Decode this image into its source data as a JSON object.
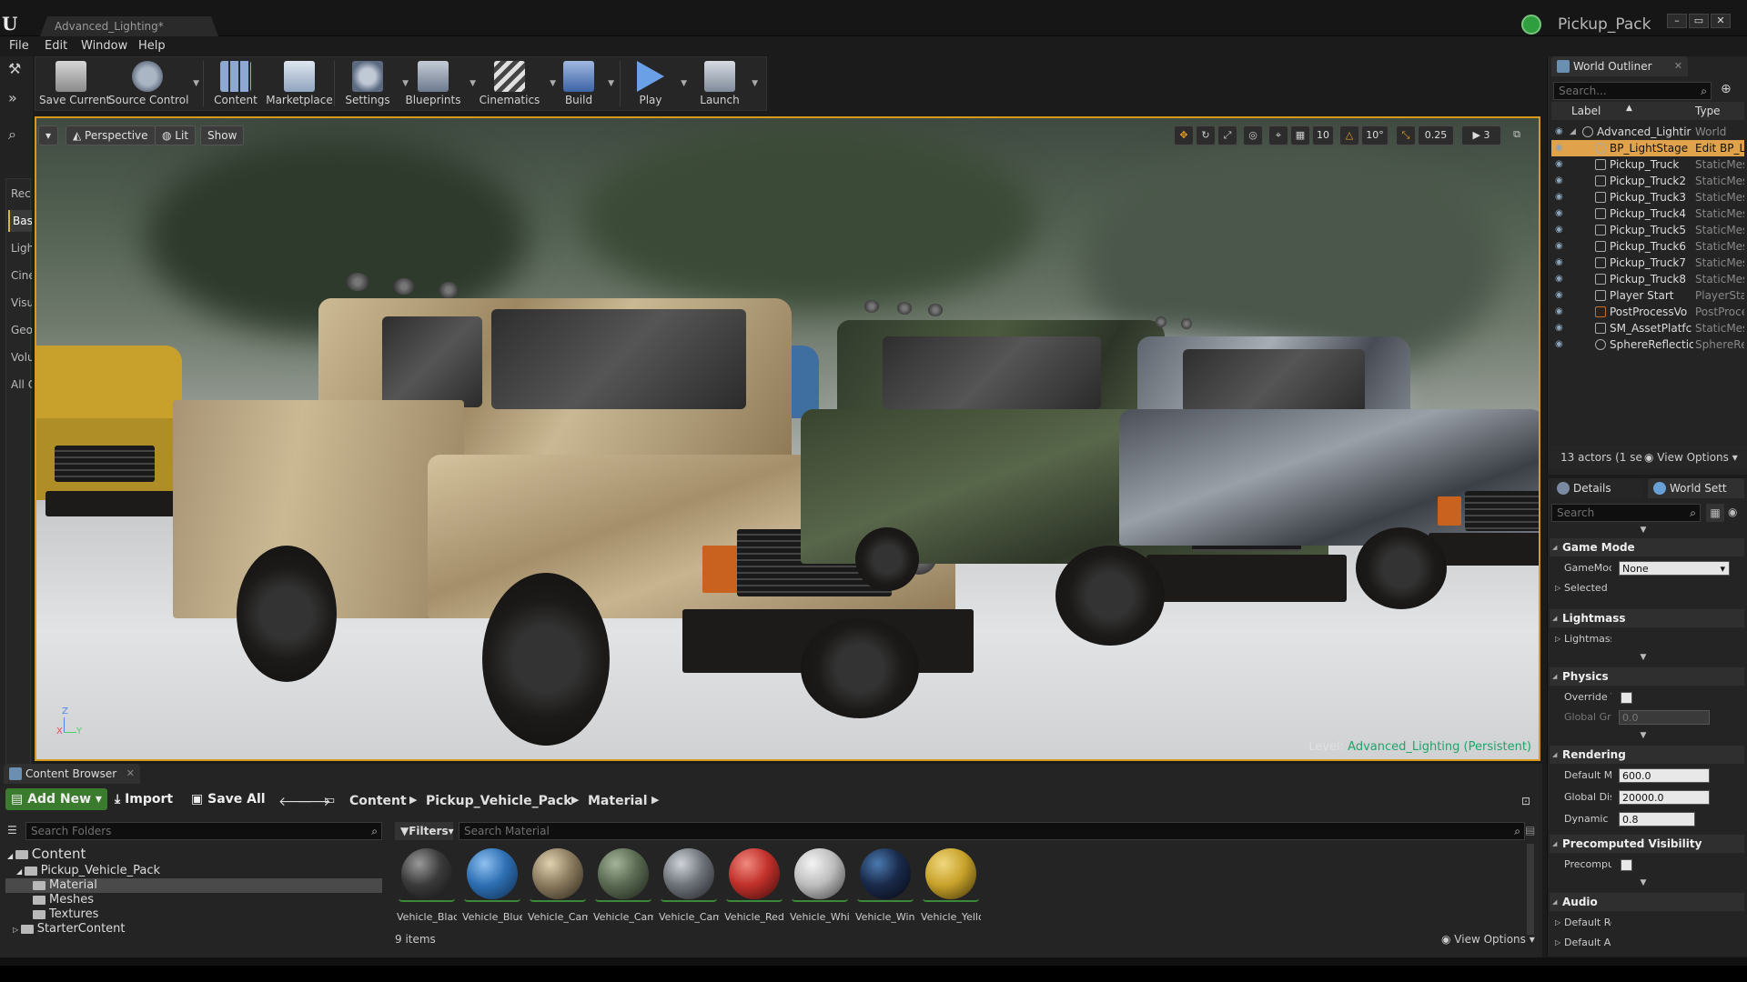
{
  "titlebar": {
    "doc_tab": "Advanced_Lighting*",
    "project_name": "Pickup_Pack",
    "window_buttons": [
      "–",
      "▭",
      "✕"
    ]
  },
  "menu": [
    "File",
    "Edit",
    "Window",
    "Help"
  ],
  "modes": [
    "Rec",
    "Bas",
    "Ligh",
    "Cine",
    "Visu",
    "Geo",
    "Volu",
    "All C"
  ],
  "toolbar": {
    "buttons": [
      {
        "label": "Save Current",
        "icon": "save-icon"
      },
      {
        "label": "Source Control",
        "icon": "source-control-icon"
      },
      {
        "label": "Content",
        "icon": "content-icon"
      },
      {
        "label": "Marketplace",
        "icon": "marketplace-icon"
      },
      {
        "label": "Settings",
        "icon": "settings-icon"
      },
      {
        "label": "Blueprints",
        "icon": "blueprints-icon"
      },
      {
        "label": "Cinematics",
        "icon": "cinematics-icon"
      },
      {
        "label": "Build",
        "icon": "build-icon"
      },
      {
        "label": "Play",
        "icon": "play-icon"
      },
      {
        "label": "Launch",
        "icon": "launch-icon"
      }
    ]
  },
  "viewport": {
    "perspective": "Perspective",
    "lit": "Lit",
    "show": "Show",
    "grid_snap": "10",
    "rotation_snap": "10°",
    "scale_snap": "0.25",
    "camera_speed": "3",
    "level_label": "Level:",
    "level_name": "Advanced_Lighting (Persistent)",
    "axis_z": "Z",
    "axis_x": "X",
    "axis_y": "Y"
  },
  "outliner": {
    "tab": "World Outliner",
    "search_placeholder": "Search...",
    "col_label": "Label",
    "col_type": "Type",
    "rows": [
      {
        "label": "Advanced_Lightir",
        "type": "World"
      },
      {
        "label": "BP_LightStage",
        "type": "Edit BP_L"
      },
      {
        "label": "Pickup_Truck",
        "type": "StaticMes"
      },
      {
        "label": "Pickup_Truck2",
        "type": "StaticMes"
      },
      {
        "label": "Pickup_Truck3",
        "type": "StaticMes"
      },
      {
        "label": "Pickup_Truck4",
        "type": "StaticMes"
      },
      {
        "label": "Pickup_Truck5",
        "type": "StaticMes"
      },
      {
        "label": "Pickup_Truck6",
        "type": "StaticMes"
      },
      {
        "label": "Pickup_Truck7",
        "type": "StaticMes"
      },
      {
        "label": "Pickup_Truck8",
        "type": "StaticMes"
      },
      {
        "label": "Player Start",
        "type": "PlayerStar"
      },
      {
        "label": "PostProcessVo",
        "type": "PostProce"
      },
      {
        "label": "SM_AssetPlatfc",
        "type": "StaticMes"
      },
      {
        "label": "SphereReflectic",
        "type": "SphereRef"
      }
    ],
    "footer": "13 actors (1 se",
    "view_options": "View Options"
  },
  "details": {
    "tab_details": "Details",
    "tab_world": "World Sett",
    "search_placeholder": "Search",
    "categories": {
      "game_mode": "Game Mode",
      "lightmass": "Lightmass",
      "physics": "Physics",
      "rendering": "Rendering",
      "precomputed": "Precomputed Visibility",
      "audio": "Audio"
    },
    "props": {
      "gamemode_name": "GameMod",
      "gamemode_value": "None",
      "selected_name": "Selected (",
      "lightmass_name": "Lightmass",
      "override_name": "Override W",
      "global_grav_name": "Global Grav",
      "global_grav_value": "0.0",
      "default_max_name": "Default Ma",
      "default_max_value": "600.0",
      "global_dist_name": "Global Dist",
      "global_dist_value": "20000.0",
      "dynamic_name": "Dynamic Ir",
      "dynamic_value": "0.8",
      "precompute_name": "Precomput",
      "default_rev_name": "Default Re",
      "default_amb_name": "Default Am"
    }
  },
  "content_browser": {
    "tab": "Content Browser",
    "add_new": "Add New",
    "import": "Import",
    "save_all": "Save All",
    "breadcrumb": [
      "Content",
      "Pickup_Vehicle_Pack",
      "Material"
    ],
    "search_folders": "Search Folders",
    "filters": "Filters",
    "search_material": "Search Material",
    "tree": [
      "Content",
      "Pickup_Vehicle_Pack",
      "Material",
      "Meshes",
      "Textures",
      "StarterContent"
    ],
    "assets": [
      {
        "name": "Vehicle_Black",
        "color": "#3a3a3a"
      },
      {
        "name": "Vehicle_Blue",
        "color": "#2d6fb3"
      },
      {
        "name": "Vehicle_Camouflage_",
        "color": "#8a7a5e"
      },
      {
        "name": "Vehicle_Camouflage_",
        "color": "#5a6a52"
      },
      {
        "name": "Vehicle_Camouflage_",
        "color": "#6e737a"
      },
      {
        "name": "Vehicle_Red",
        "color": "#c0302a"
      },
      {
        "name": "Vehicle_White",
        "color": "#bdbdbd"
      },
      {
        "name": "Vehicle_Windows",
        "color": "#1a2a4a"
      },
      {
        "name": "Vehicle_Yellow",
        "color": "#c8a22a"
      }
    ],
    "item_count": "9 items",
    "view_options": "View Options"
  }
}
